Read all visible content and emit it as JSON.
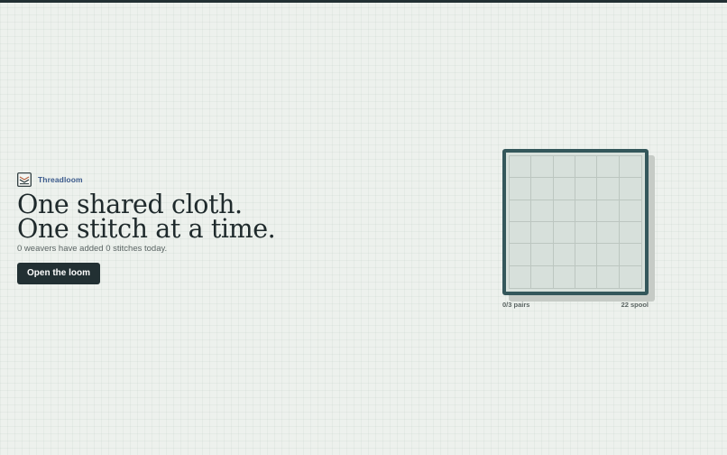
{
  "brand": {
    "name": "Threadloom",
    "logo_icon": "loom-frame-icon"
  },
  "hero": {
    "headline_line1": "One shared cloth.",
    "headline_line2": "One stitch at a time.",
    "subtitle": "0 weavers have added 0 stitches today.",
    "cta_label": "Open the loom"
  },
  "loom": {
    "rows": 6,
    "cols": 6,
    "pairs_label": "0/3 pairs",
    "spool_label": "22 spool"
  },
  "colors": {
    "background": "#edf1ed",
    "ink": "#1f2a2c",
    "brand": "#3b5a8c",
    "button": "#223033",
    "loom_frame": "#34575b",
    "loom_cloth": "#d8e1dc"
  }
}
